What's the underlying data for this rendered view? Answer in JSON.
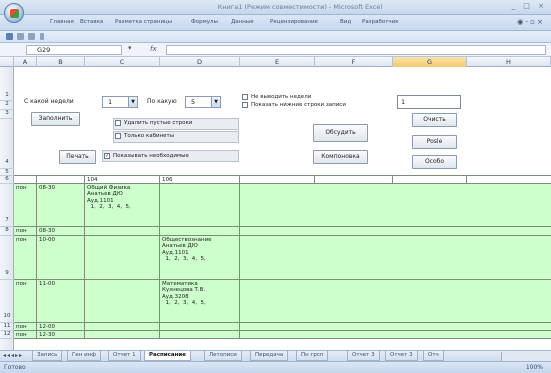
{
  "window": {
    "title": "Книга1 (Режим совместимости) - Microsoft Excel",
    "controls": "_ □ ×"
  },
  "ribbon": {
    "tabs": [
      "Главная",
      "Вставка",
      "Разметка страницы",
      "Формулы",
      "Данные",
      "Рецензирование",
      "Вид",
      "Разработчик"
    ],
    "tools": "◉ - ▫ ×"
  },
  "formula_bar": {
    "name_box": "G29",
    "fx": "fx",
    "formula": ""
  },
  "columns": [
    "A",
    "B",
    "C",
    "D",
    "E",
    "F",
    "G",
    "H"
  ],
  "selected_column": "G",
  "rows": [
    "1",
    "2",
    "3",
    "",
    "4",
    "5",
    "6",
    "",
    "7",
    "8",
    "",
    "9",
    "",
    "10",
    "11",
    "12"
  ],
  "panel": {
    "week_from_label": "С какой недели",
    "week_from_value": "1",
    "course_label": "По какую",
    "course_value": "5",
    "chk_no_week": "Не выводить недели",
    "chk_show_lines": "Показать нижние строки записи",
    "fill_button": "Заполнить",
    "delete_empty": "Удалить пустые строки",
    "only_rooms": "Только кабинеты",
    "discuss_button": "Обсудить",
    "print_button": "Печать",
    "show_required": "Показывать необходимые",
    "compose_button": "Компоновка",
    "input_value": "1",
    "btn_right1": "Очисть",
    "btn_right2": "Posle",
    "btn_right3": "Особо"
  },
  "table": {
    "header_row": [
      "",
      "",
      "104",
      "106",
      "",
      "",
      "",
      ""
    ],
    "rows": [
      {
        "day": "пон",
        "time": "08-30",
        "c": "Общий Физика\nАнатьев ДЮ\nАуд.1101\n  1,  2,  3,  4,  5,",
        "d": ""
      },
      {
        "day": "пон",
        "time": "08-30",
        "c": "",
        "d": ""
      },
      {
        "day": "пон",
        "time": "10-00",
        "c": "",
        "d": "Обществознание\nАнатьев ДЮ\nАуд.1101\n  1,  2,  3,  4,  5,"
      },
      {
        "day": "пон",
        "time": "11-00",
        "c": "",
        "d": "Математика\nКузнецова Т.В.\nАуд.3208\n  1,  2,  3,  4,  5,"
      },
      {
        "day": "пон",
        "time": "12-00",
        "c": "",
        "d": ""
      },
      {
        "day": "пон",
        "time": "12-30",
        "c": "",
        "d": ""
      }
    ]
  },
  "sheets": [
    "Запись",
    "Ген инф",
    "Отчет 1",
    "Расписание",
    "Летописи",
    "Передача",
    "Пн грсп",
    "Отчет 3",
    "Отчет 3",
    "Отч"
  ],
  "active_sheet": "Расписание",
  "status": {
    "left": "Готово",
    "zoom": "100%"
  }
}
